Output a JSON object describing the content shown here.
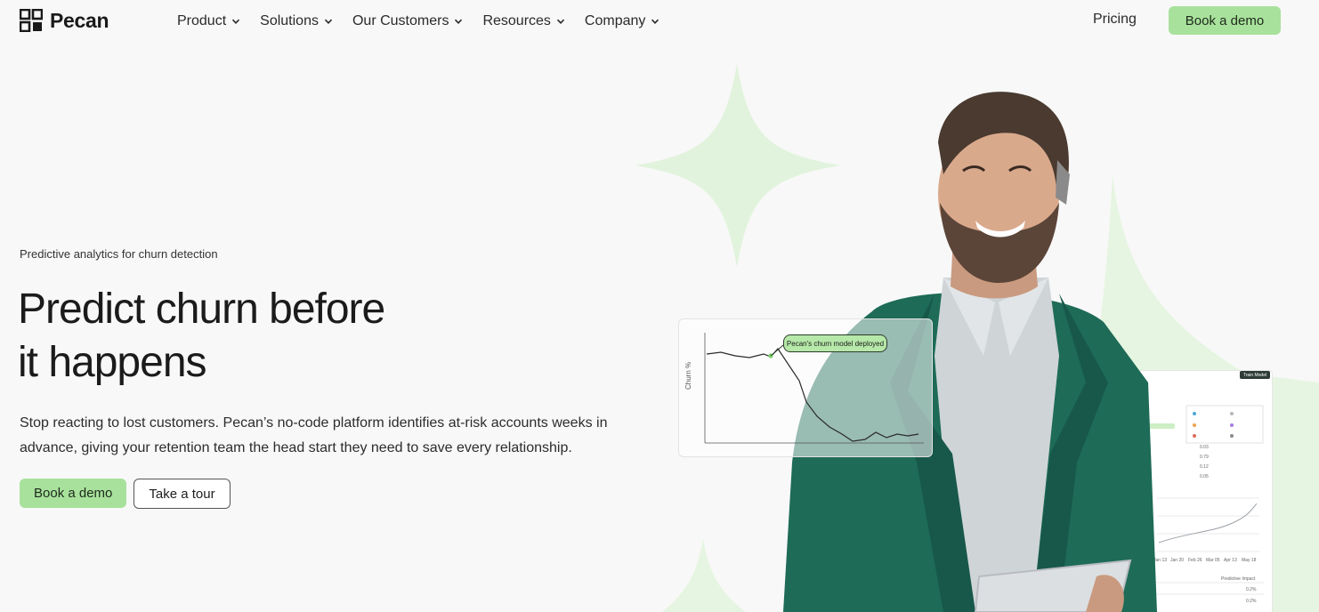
{
  "brand": {
    "name": "Pecan"
  },
  "nav": {
    "items": [
      {
        "label": "Product"
      },
      {
        "label": "Solutions"
      },
      {
        "label": "Our Customers"
      },
      {
        "label": "Resources"
      },
      {
        "label": "Company"
      }
    ],
    "pricing": "Pricing",
    "cta": "Book a demo"
  },
  "hero": {
    "eyebrow": "Predictive analytics for churn detection",
    "headline_line1": "Predict churn before",
    "headline_line2": "it happens",
    "subcopy": "Stop reacting to lost customers. Pecan’s no-code platform identifies at-risk accounts weeks in advance, giving your retention team the head start they need to save every relationship.",
    "primary_cta": "Book a demo",
    "secondary_cta": "Take a tour"
  },
  "churn_card": {
    "y_label": "Churn %",
    "annotation": "Pecan's churn model deployed"
  },
  "dashboard": {
    "badge": "Train Model",
    "values": [
      "0.03",
      "0.79",
      "0.12",
      "0.05"
    ],
    "sidebar_label": "Predictive Impact",
    "percent_values": [
      "0.2%",
      "0.2%"
    ],
    "x_ticks": [
      "Jan 13",
      "Jan 20",
      "Feb 26",
      "Mar 05",
      "Apr 13",
      "May 18"
    ]
  },
  "colors": {
    "accent_green": "#a8e19c",
    "tooltip_green": "#b6e8a9",
    "deco_green": "#dff3da",
    "jacket": "#1f6e59",
    "text_dark": "#1b1b1b"
  },
  "icons": [
    "pecan-logo-icon",
    "chevron-down-icon"
  ]
}
